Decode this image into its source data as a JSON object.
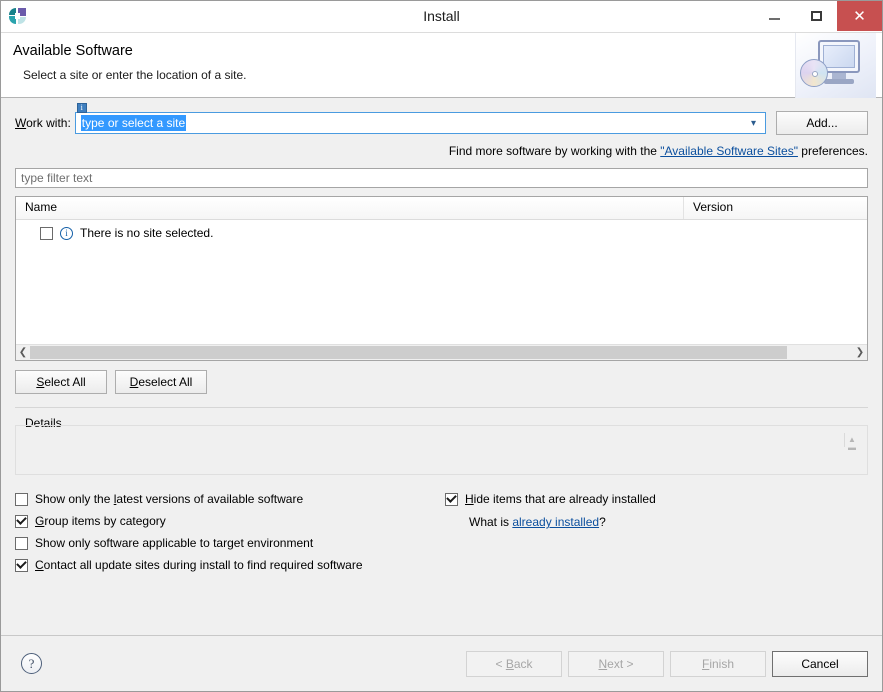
{
  "window": {
    "title": "Install",
    "app_icon": "eclipse-icon",
    "minimize_label": "Minimize",
    "maximize_label": "Maximize",
    "close_label": "Close",
    "close_color": "#c75050"
  },
  "banner": {
    "title": "Available Software",
    "subtitle": "Select a site or enter the location of a site.",
    "graphic": "monitor-with-disc-icon"
  },
  "work_with": {
    "label": "Work with:",
    "decoration_badge": "info-decoration-icon",
    "value": "type or select a site",
    "placeholder": "type or select a site",
    "selected": true,
    "selection_color": "#3399ff",
    "dropdown_icon": "chevron-down-icon",
    "add_button": "Add..."
  },
  "find_more": {
    "prefix": "Find more software by working with the ",
    "link": "\"Available Software Sites\"",
    "suffix": " preferences.",
    "link_color": "#0b4f9e"
  },
  "filter": {
    "placeholder": "type filter text",
    "value": ""
  },
  "table": {
    "columns": [
      "Name",
      "Version"
    ],
    "rows": [
      {
        "checked": false,
        "icon": "info-icon",
        "name": "There is no site selected.",
        "version": ""
      }
    ],
    "hscroll": {
      "left_arrow": "chevron-left-icon",
      "right_arrow": "chevron-right-icon",
      "thumb_percent": 92
    }
  },
  "selection_buttons": {
    "select_all": "Select All",
    "deselect_all": "Deselect All"
  },
  "details": {
    "legend": "Details",
    "content": "",
    "sizer_icon": "resize-grip-icon"
  },
  "options": {
    "left": [
      {
        "label": "Show only the latest versions of available software",
        "checked": false,
        "mnemonic": "l"
      },
      {
        "label": "Group items by category",
        "checked": true,
        "mnemonic": "G"
      },
      {
        "label": "Show only software applicable to target environment",
        "checked": false,
        "mnemonic": ""
      },
      {
        "label": "Contact all update sites during install to find required software",
        "checked": true,
        "mnemonic": "C"
      }
    ],
    "right": {
      "checkbox": {
        "label": "Hide items that are already installed",
        "checked": true,
        "mnemonic": "H"
      },
      "what_is_prefix": "What is ",
      "what_is_link": "already installed",
      "what_is_suffix": "?"
    }
  },
  "footer": {
    "help_icon": "help-question-icon",
    "buttons": [
      {
        "label": "< Back",
        "enabled": false
      },
      {
        "label": "Next >",
        "enabled": false
      },
      {
        "label": "Finish",
        "enabled": false
      },
      {
        "label": "Cancel",
        "enabled": true
      }
    ]
  }
}
